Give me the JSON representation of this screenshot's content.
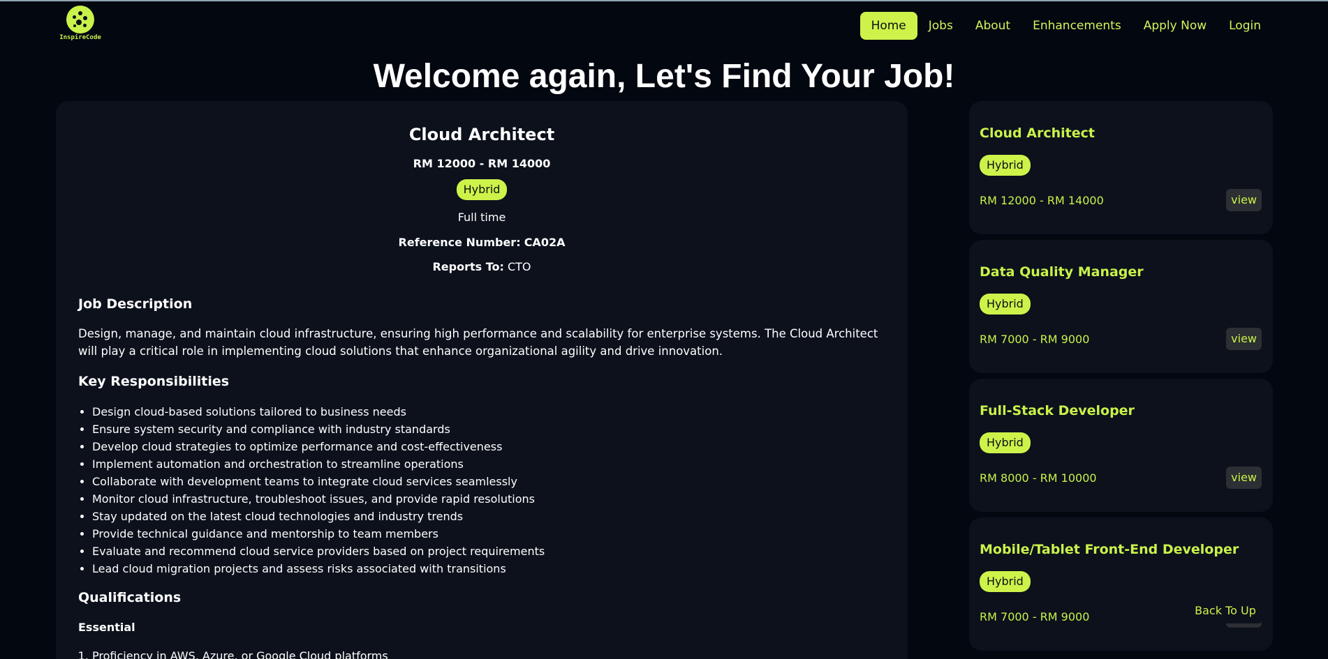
{
  "brand": {
    "logo_text": "InspireCode"
  },
  "nav": {
    "items": [
      {
        "label": "Home",
        "active": true
      },
      {
        "label": "Jobs"
      },
      {
        "label": "About"
      },
      {
        "label": "Enhancements"
      },
      {
        "label": "Apply Now"
      },
      {
        "label": "Login"
      }
    ]
  },
  "page": {
    "title": "Welcome again, Let's Find Your Job!"
  },
  "detail": {
    "title": "Cloud Architect",
    "salary": "RM 12000 - RM 14000",
    "work_mode": "Hybrid",
    "employment_type": "Full time",
    "reference_label": "Reference Number:",
    "reference_value": "CA02A",
    "reports_label": "Reports To:",
    "reports_value": "CTO",
    "description_heading": "Job Description",
    "description": "Design, manage, and maintain cloud infrastructure, ensuring high performance and scalability for enterprise systems. The Cloud Architect will play a critical role in implementing cloud solutions that enhance organizational agility and drive innovation.",
    "responsibilities_heading": "Key Responsibilities",
    "responsibilities": [
      "Design cloud-based solutions tailored to business needs",
      "Ensure system security and compliance with industry standards",
      "Develop cloud strategies to optimize performance and cost-effectiveness",
      "Implement automation and orchestration to streamline operations",
      "Collaborate with development teams to integrate cloud services seamlessly",
      "Monitor cloud infrastructure, troubleshoot issues, and provide rapid resolutions",
      "Stay updated on the latest cloud technologies and industry trends",
      "Provide technical guidance and mentorship to team members",
      "Evaluate and recommend cloud service providers based on project requirements",
      "Lead cloud migration projects and assess risks associated with transitions"
    ],
    "qualifications_heading": "Qualifications",
    "essential_heading": "Essential",
    "essential": [
      "Proficiency in AWS, Azure, or Google Cloud platforms"
    ]
  },
  "sidebar": {
    "jobs": [
      {
        "title": "Cloud Architect",
        "mode": "Hybrid",
        "salary": "RM 12000 - RM 14000",
        "view_label": "view"
      },
      {
        "title": "Data Quality Manager",
        "mode": "Hybrid",
        "salary": "RM 7000 - RM 9000",
        "view_label": "view"
      },
      {
        "title": "Full-Stack Developer",
        "mode": "Hybrid",
        "salary": "RM 8000 - RM 10000",
        "view_label": "view"
      },
      {
        "title": "Mobile/Tablet Front-End Developer",
        "mode": "Hybrid",
        "salary": "RM 7000 - RM 9000",
        "view_label": "view"
      }
    ]
  },
  "back_to_top": "Back To Up",
  "colors": {
    "accent": "#cdf34a",
    "background": "#020710",
    "card": "#0c111c"
  }
}
